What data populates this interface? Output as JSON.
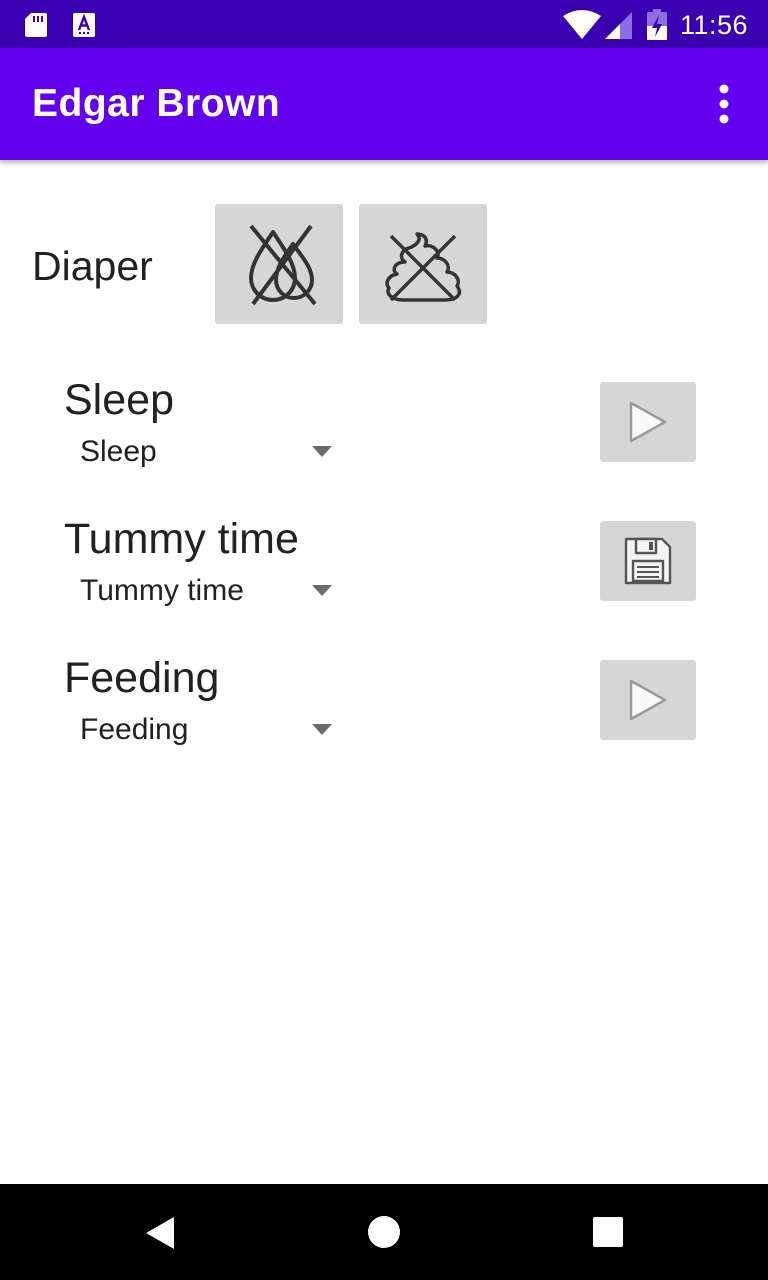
{
  "status_bar": {
    "time": "11:56",
    "left_icons": [
      "sd-card-icon",
      "text-a-icon"
    ],
    "right_icons": [
      "wifi-icon",
      "signal-icon",
      "battery-icon"
    ],
    "color": "#3a00b0"
  },
  "app_bar": {
    "title": "Edgar Brown",
    "menu_icon": "more-vert-icon",
    "color": "#6200ee"
  },
  "diaper": {
    "label": "Diaper",
    "buttons": [
      {
        "name": "wet-diaper-button",
        "icon": "no-drops-icon"
      },
      {
        "name": "dirty-diaper-button",
        "icon": "no-poop-icon"
      }
    ]
  },
  "activities": [
    {
      "title": "Sleep",
      "selected": "Sleep",
      "action_icon": "play-icon"
    },
    {
      "title": "Tummy time",
      "selected": "Tummy time",
      "action_icon": "save-icon"
    },
    {
      "title": "Feeding",
      "selected": "Feeding",
      "action_icon": "play-icon"
    }
  ],
  "nav_bar": {
    "buttons": [
      "back-icon",
      "home-icon",
      "recents-icon"
    ],
    "color": "#000000"
  }
}
